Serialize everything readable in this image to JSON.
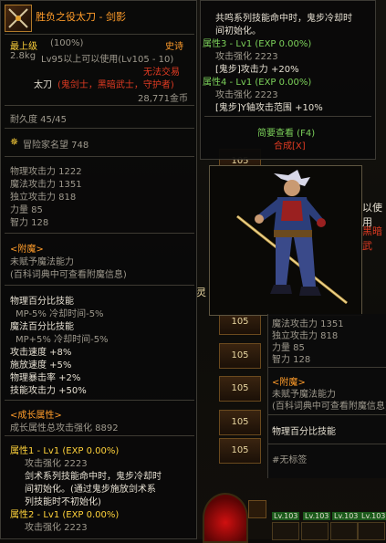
{
  "item": {
    "name": "胜负之役太刀 - 剑影",
    "grade": "最上级",
    "grade_pct": "(100%)",
    "rarity": "史诗",
    "weight": "2.8kg",
    "level_req": "Lv95以上可以使用(Lv105 - 10)",
    "trade": "无法交易",
    "type": "太刀",
    "class_req": "(鬼剑士，黑暗武士，守护者)",
    "price": "28,771金币",
    "durability": "耐久度 45/45",
    "adventure_fame": "冒险家名望 748",
    "stats": [
      "物理攻击力 1222",
      "魔法攻击力 1351",
      "独立攻击力 818",
      "力量 85",
      "智力 128"
    ],
    "enchant_header": "<附魔>",
    "enchant_lines": [
      "未赋予魔法能力",
      "(百科词典中可查看附魔信息)"
    ],
    "pct_skill_header": "物理百分比技能",
    "mp_lines": [
      "MP-5% 冷却时间-5%",
      "魔法百分比技能",
      "MP+5% 冷却时间-5%"
    ],
    "bonus_lines": [
      "攻击速度 +8%",
      "施放速度 +5%",
      "物理暴击率 +2%",
      "技能攻击力 +50%"
    ],
    "growth_header": "<成长属性>",
    "growth_total": "成长属性总攻击强化 8892",
    "growth_attrs": [
      {
        "title": "属性1 - Lv1 (EXP 0.00%)",
        "lines": [
          "攻击强化 2223",
          "剑术系列技能命中时，鬼步冷却时",
          "间初始化。(通过鬼步施放剑术系",
          "列技能时不初始化)"
        ]
      },
      {
        "title": "属性2 - Lv1 (EXP 0.00%)",
        "lines": [
          "攻击强化 2223"
        ]
      }
    ]
  },
  "right_tooltip": {
    "lines_top": [
      "共鸣系列技能命中时，鬼步冷却时",
      "间初始化。"
    ],
    "attr3_title": "属性3 - Lv1 (EXP 0.00%)",
    "attr3_lines": [
      "攻击强化 2223",
      "[鬼步]攻击力 +20%"
    ],
    "attr4_title": "属性4 - Lv1 (EXP 0.00%)",
    "attr4_lines": [
      "攻击强化 2223",
      "[鬼步]Y轴攻击范围 +10%"
    ],
    "brief_view": "简要查看 (F4)",
    "synthesis": "合成[X]"
  },
  "lower_tooltip": {
    "stats": [
      "魔法攻击力 1351",
      "独立攻击力 818",
      "力量 85",
      "智力 128"
    ],
    "enchant_header": "<附魔>",
    "enchant_lines": [
      "未赋予魔法能力",
      "(百科词典中可查看附魔信息)"
    ],
    "pct_skill": "物理百分比技能",
    "tag": "#无标签"
  },
  "background": {
    "row_values": [
      "105",
      "105",
      "105",
      "105",
      "105",
      "105",
      "105",
      "105"
    ],
    "side_text_1": "以使用",
    "side_text_2": "黑暗武",
    "side_text_3": "灵",
    "bottom_levels": [
      "Lv.103",
      "Lv.103",
      "Lv.103",
      "Lv.103"
    ]
  },
  "colors": {
    "epic_orange": "#ff9c2a",
    "grade_yellow": "#ffd23a",
    "no_trade_red": "#e03a22",
    "growth_green": "#7cd15a"
  }
}
